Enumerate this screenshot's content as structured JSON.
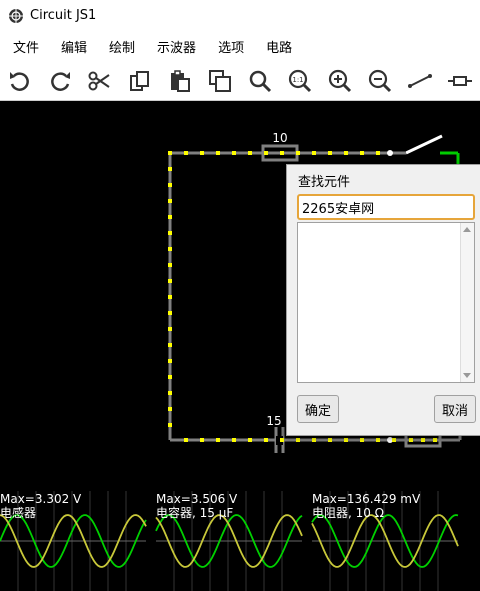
{
  "window": {
    "title": "Circuit JS1"
  },
  "menu": [
    "文件",
    "编辑",
    "绘制",
    "示波器",
    "选项",
    "电路"
  ],
  "toolbar": {
    "icons": [
      "undo-icon",
      "redo-icon",
      "cut-icon",
      "copy-icon",
      "paste-icon",
      "duplicate-icon",
      "search-icon",
      "zoom-fit-icon",
      "zoom-in-icon",
      "zoom-out-icon",
      "wire-icon",
      "resistor-icon"
    ],
    "zoom_fit_label": "1:1"
  },
  "circuit": {
    "resistor_label": "10",
    "capacitor_label": "15",
    "colors": {
      "wire": "#808080",
      "current_dot": "#ffff00",
      "active_wire": "#00cc00",
      "switch": "#ffffff"
    }
  },
  "dialog": {
    "title": "查找元件",
    "search_value": "2265安卓网",
    "ok_label": "确定",
    "cancel_label": "取消"
  },
  "scopes": [
    {
      "max": "Max=3.302 V",
      "name": "电感器"
    },
    {
      "max": "Max=3.506 V",
      "name": "电容器, 15 µF"
    },
    {
      "max": "Max=136.429 mV",
      "name": "电阻器, 10 Ω"
    }
  ]
}
